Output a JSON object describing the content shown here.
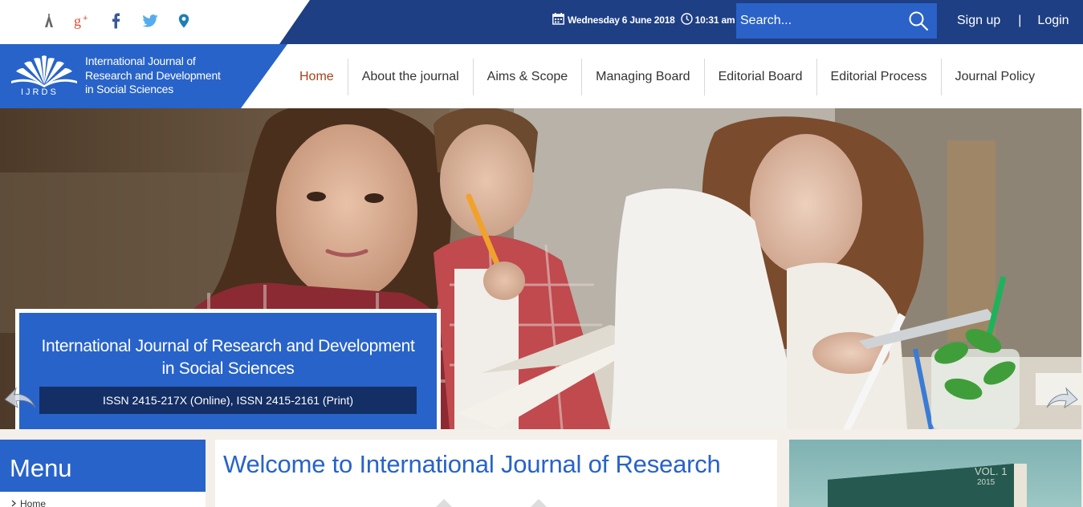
{
  "topbar": {
    "social": [
      "tools-icon",
      "google-plus-icon",
      "facebook-icon",
      "twitter-icon",
      "location-pin-icon"
    ],
    "date": "Wednesday 6 June 2018",
    "time": "10:31 am",
    "search_placeholder": "Search...",
    "signup": "Sign up",
    "separator": "|",
    "login": "Login"
  },
  "logo": {
    "abbr": "IJRDS",
    "line1": "International Journal of",
    "line2": "Research and Development",
    "line3": "in Social Sciences"
  },
  "nav": {
    "items": [
      {
        "label": "Home",
        "active": true
      },
      {
        "label": "About the journal"
      },
      {
        "label": "Aims & Scope"
      },
      {
        "label": "Managing Board"
      },
      {
        "label": "Editorial Board"
      },
      {
        "label": "Editorial Process"
      },
      {
        "label": "Journal Policy"
      }
    ]
  },
  "hero": {
    "title_line1": "International Journal of Research and Development",
    "title_line2": "in Social Sciences",
    "issn": "ISSN 2415-217X (Online), ISSN 2415-2161 (Print)"
  },
  "menu": {
    "title": "Menu",
    "first_item": "Home"
  },
  "welcome": {
    "title": "Welcome to International Journal of Research"
  },
  "book": {
    "vol": "VOL. 1",
    "year": "2015"
  },
  "colors": {
    "dark_blue": "#1e3f84",
    "brand_blue": "#2863c9",
    "navy": "#142f66",
    "active_nav": "#a8401a"
  }
}
